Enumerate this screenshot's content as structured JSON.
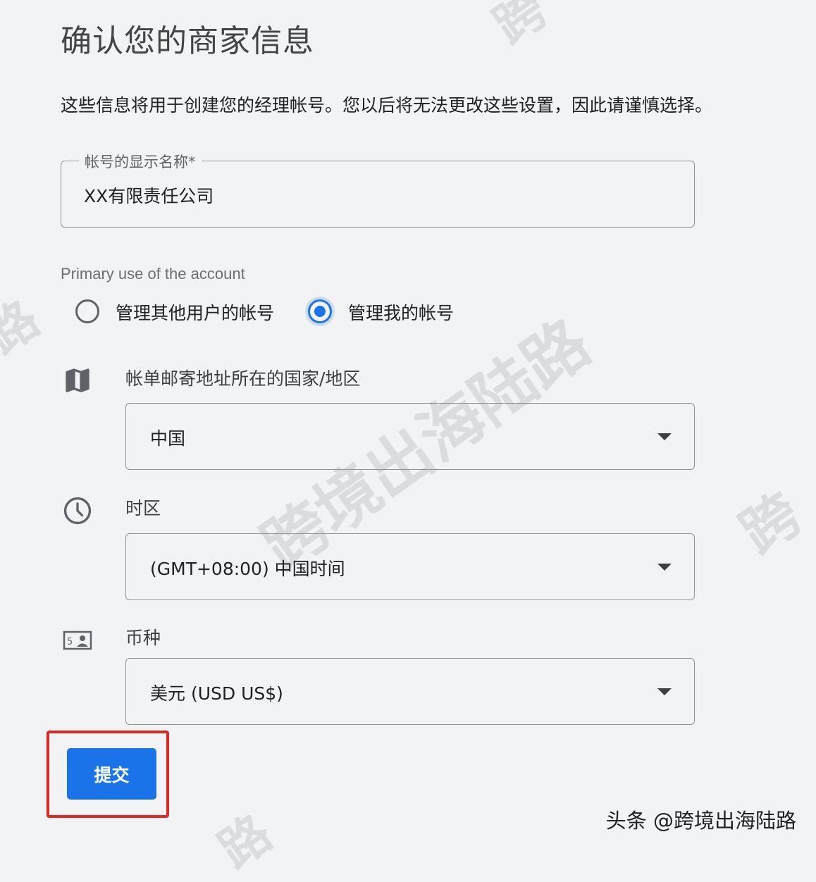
{
  "page": {
    "title": "确认您的商家信息",
    "description": "这些信息将用于创建您的经理帐号。您以后将无法更改这些设置，因此请谨慎选择。"
  },
  "account_name": {
    "label": "帐号的显示名称*",
    "value": "XX有限责任公司"
  },
  "primary_use": {
    "label": "Primary use of the account",
    "options": [
      {
        "label": "管理其他用户的帐号",
        "selected": false
      },
      {
        "label": "管理我的帐号",
        "selected": true
      }
    ]
  },
  "country": {
    "icon": "map-icon",
    "label": "帐单邮寄地址所在的国家/地区",
    "value": "中国"
  },
  "timezone": {
    "icon": "clock-icon",
    "label": "时区",
    "value": "(GMT+08:00) 中国时间"
  },
  "currency": {
    "icon": "currency-icon",
    "label": "币种",
    "value": "美元 (USD US$)"
  },
  "submit": {
    "label": "提交",
    "highlight_color": "#e0281f"
  },
  "footer": {
    "credit": "头条 @跨境出海陆路"
  },
  "watermark": {
    "text": "跨境出海陆路"
  },
  "colors": {
    "accent": "#1a73e8",
    "background": "#f1f3f4"
  }
}
